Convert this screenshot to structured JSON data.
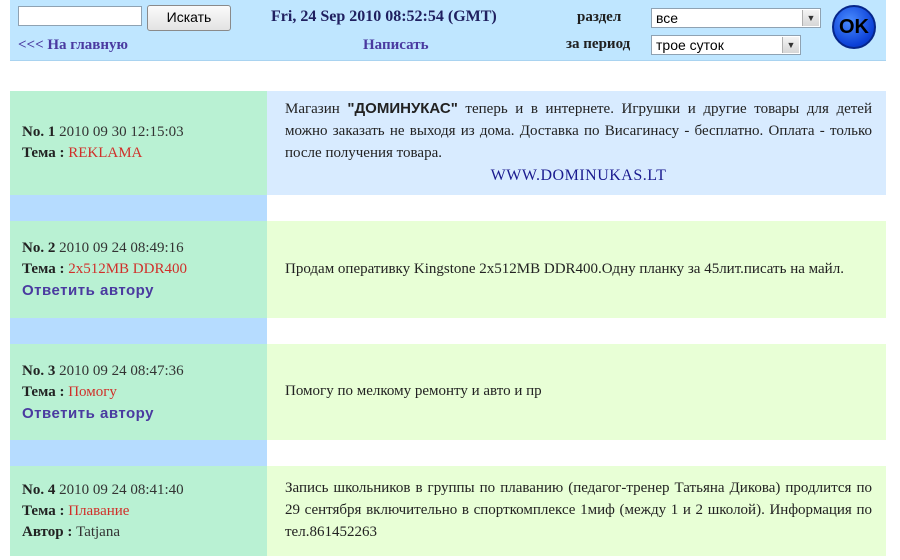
{
  "header": {
    "search_placeholder": "",
    "search_button": "Искать",
    "back_link": "<<< На главную",
    "datetime": "Fri, 24 Sep 2010 08:52:54 (GMT)",
    "write_link": "Написать",
    "section_label": "раздел",
    "section_value": "все",
    "period_label": "за период",
    "period_value": "трое суток",
    "ok_button": "OK"
  },
  "posts": [
    {
      "no_label": "No. 1",
      "date": "2010 09 30 12:15:03",
      "topic_label": "Тема :",
      "topic": "REKLAMA",
      "body_before": "Магазин ",
      "body_bold": "\"ДОМИНУКАС\"",
      "body_after": " теперь и в интернете. Игрушки и другие товары для детей можно заказать не выходя из дома. Доставка по Висагинасу - бесплатно. Оплата - только после получения товара.",
      "link": "WWW.DOMINUKAS.LT"
    },
    {
      "no_label": "No. 2",
      "date": "2010 09 24 08:49:16",
      "topic_label": "Тема :",
      "topic": "2x512MB DDR400",
      "reply": "Ответить автору",
      "body": "Продам оперативку Kingstone 2x512MB DDR400.Одну планку за 45лит.писать на майл."
    },
    {
      "no_label": "No. 3",
      "date": "2010 09 24 08:47:36",
      "topic_label": "Тема :",
      "topic": "Помогу",
      "reply": "Ответить автору",
      "body": "Помогу по мелкому ремонту и авто и пр"
    },
    {
      "no_label": "No. 4",
      "date": "2010 09 24 08:41:40",
      "topic_label": "Тема :",
      "topic": "Плавание",
      "author_label": "Автор :",
      "author": "Tatjana",
      "body": "Запись школьников в группы по плаванию (педагог-тренер Татьяна Дикова) продлится по 29 сентября включительно в спорткомплексе 1миф (между 1 и 2 школой). Информация по тел.861452263"
    }
  ],
  "colors": {
    "header_bg": "#bfe6ff",
    "meta_bg": "#b9f1d3",
    "spacer_bg": "#b6dcff",
    "ad_body_bg": "#d8ebff",
    "post_body_bg": "#e8ffd6",
    "topic_color": "#d0302a",
    "link_color": "#4a3aa0"
  }
}
